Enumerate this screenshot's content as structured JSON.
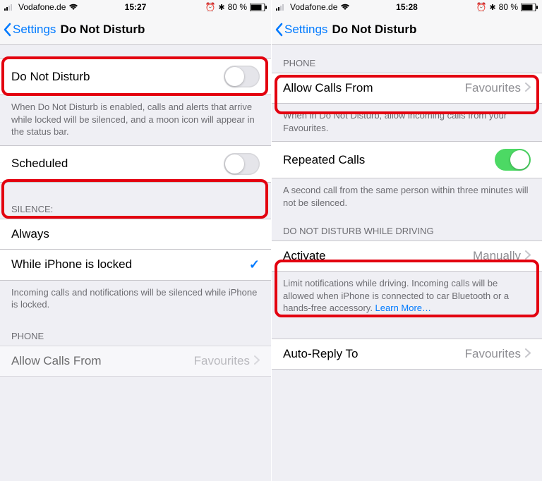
{
  "left": {
    "status": {
      "carrier": "Vodafone.de",
      "time": "15:27",
      "batteryText": "80 %"
    },
    "nav": {
      "back": "Settings",
      "title": "Do Not Disturb"
    },
    "dnd": {
      "label": "Do Not Disturb",
      "on": false
    },
    "dndFooter": "When Do Not Disturb is enabled, calls and alerts that arrive while locked will be silenced, and a moon icon will appear in the status bar.",
    "scheduled": {
      "label": "Scheduled",
      "on": false
    },
    "silenceHeader": "SILENCE:",
    "silence": {
      "always": "Always",
      "locked": "While iPhone is locked",
      "selected": "locked"
    },
    "silenceFooter": "Incoming calls and notifications will be silenced while iPhone is locked.",
    "phoneHeader": "PHONE",
    "allowCalls": {
      "label": "Allow Calls From",
      "value": "Favourites"
    }
  },
  "right": {
    "status": {
      "carrier": "Vodafone.de",
      "time": "15:28",
      "batteryText": "80 %"
    },
    "nav": {
      "back": "Settings",
      "title": "Do Not Disturb"
    },
    "phoneHeader": "PHONE",
    "allowCalls": {
      "label": "Allow Calls From",
      "value": "Favourites"
    },
    "allowCallsFooter": "When in Do Not Disturb, allow incoming calls from your Favourites.",
    "repeated": {
      "label": "Repeated Calls",
      "on": true
    },
    "repeatedFooter": "A second call from the same person within three minutes will not be silenced.",
    "drivingHeader": "DO NOT DISTURB WHILE DRIVING",
    "activate": {
      "label": "Activate",
      "value": "Manually"
    },
    "drivingFooter": "Limit notifications while driving. Incoming calls will be allowed when iPhone is connected to car Bluetooth or a hands-free accessory. ",
    "learnMore": "Learn More…",
    "autoReply": {
      "label": "Auto-Reply To",
      "value": "Favourites"
    }
  }
}
